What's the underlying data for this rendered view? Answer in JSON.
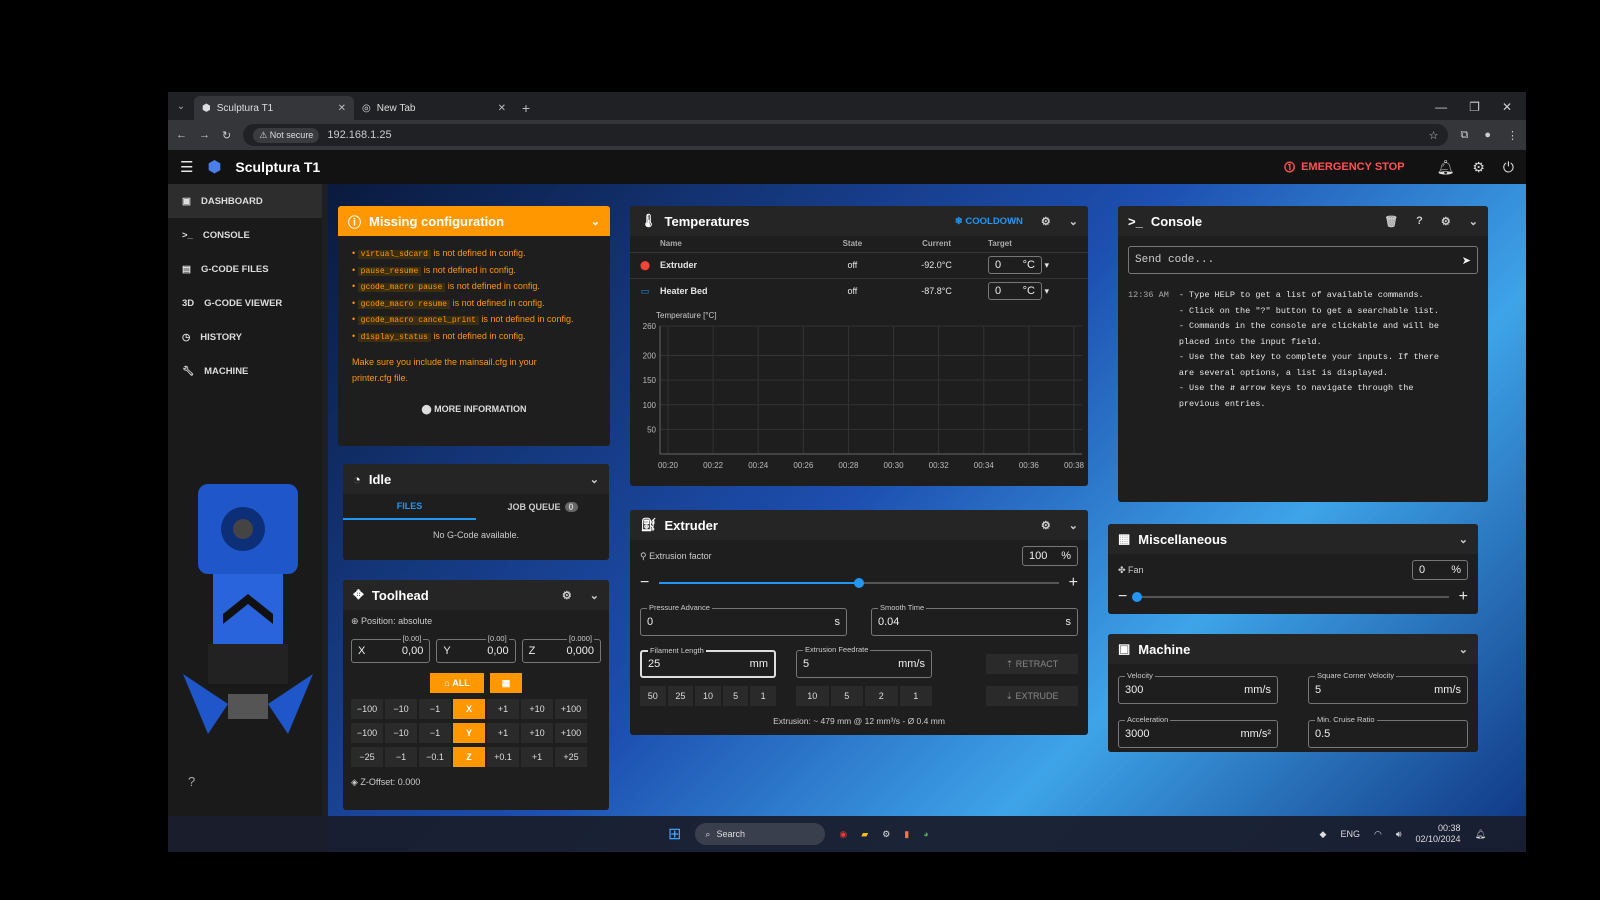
{
  "browser": {
    "tabs": [
      {
        "label": "Sculptura T1"
      },
      {
        "label": "New Tab"
      }
    ],
    "security": "Not secure",
    "url": "192.168.1.25"
  },
  "app": {
    "title": "Sculptura T1",
    "emergency": "EMERGENCY STOP"
  },
  "nav": {
    "items": [
      {
        "label": "DASHBOARD",
        "icon": "dashboard-icon"
      },
      {
        "label": "CONSOLE",
        "icon": "console-icon"
      },
      {
        "label": "G-CODE FILES",
        "icon": "files-icon"
      },
      {
        "label": "G-CODE VIEWER",
        "icon": "3d-icon"
      },
      {
        "label": "HISTORY",
        "icon": "history-icon"
      },
      {
        "label": "MACHINE",
        "icon": "wrench-icon"
      }
    ]
  },
  "missing": {
    "title": "Missing configuration",
    "items": [
      {
        "code": "virtual_sdcard",
        "text": "is not defined in config."
      },
      {
        "code": "pause_resume",
        "text": "is not defined in config."
      },
      {
        "code": "gcode_macro pause",
        "text": "is not defined in config."
      },
      {
        "code": "gcode_macro resume",
        "text": "is not defined in config."
      },
      {
        "code": "gcode_macro cancel_print",
        "text": "is not defined in config."
      },
      {
        "code": "display_status",
        "text": "is not defined in config."
      }
    ],
    "note1": "Make sure you include the mainsail.cfg in your",
    "note2": "printer.cfg file.",
    "more": "MORE INFORMATION"
  },
  "idle": {
    "title": "Idle",
    "tab_files": "FILES",
    "tab_queue": "JOB QUEUE",
    "queue_count": "0",
    "empty": "No G-Code available."
  },
  "toolhead": {
    "title": "Toolhead",
    "position": "Position: absolute",
    "x": {
      "label": "X",
      "value": "0,00",
      "hint": "[0.00]"
    },
    "y": {
      "label": "Y",
      "value": "0,00",
      "hint": "[0.00]"
    },
    "z": {
      "label": "Z",
      "value": "0,000",
      "hint": "[0.000]"
    },
    "home_all": "ALL",
    "rows": [
      [
        "−100",
        "−10",
        "−1",
        "X",
        "+1",
        "+10",
        "+100"
      ],
      [
        "−100",
        "−10",
        "−1",
        "Y",
        "+1",
        "+10",
        "+100"
      ],
      [
        "−25",
        "−1",
        "−0.1",
        "Z",
        "+0.1",
        "+1",
        "+25"
      ]
    ],
    "zoffset": "Z-Offset: 0.000"
  },
  "temps": {
    "title": "Temperatures",
    "cooldown": "COOLDOWN",
    "headers": [
      "Name",
      "State",
      "Current",
      "Target"
    ],
    "rows": [
      {
        "name": "Extruder",
        "state": "off",
        "current": "-92.0°C",
        "target": "0",
        "unit": "°C"
      },
      {
        "name": "Heater Bed",
        "state": "off",
        "current": "-87.8°C",
        "target": "0",
        "unit": "°C"
      }
    ],
    "chart_label": "Temperature [°C]"
  },
  "chart_data": {
    "type": "line",
    "title": "",
    "ylabel": "Temperature [°C]",
    "y_ticks": [
      260,
      200,
      150,
      100,
      50
    ],
    "x_ticks": [
      "00:20",
      "00:22",
      "00:24",
      "00:26",
      "00:28",
      "00:30",
      "00:32",
      "00:34",
      "00:36",
      "00:38"
    ],
    "ylim": [
      0,
      260
    ],
    "series": []
  },
  "extruder": {
    "title": "Extruder",
    "factor_label": "Extrusion factor",
    "factor": "100",
    "factor_unit": "%",
    "factor_level": 0.5,
    "pressure_label": "Pressure Advance",
    "pressure": "0",
    "pressure_unit": "s",
    "smooth_label": "Smooth Time",
    "smooth": "0.04",
    "smooth_unit": "s",
    "length_label": "Filament Length",
    "length": "25",
    "length_unit": "mm",
    "feed_label": "Extrusion Feedrate",
    "feed": "5",
    "feed_unit": "mm/s",
    "retract": "RETRACT",
    "extrude": "EXTRUDE",
    "length_presets": [
      "50",
      "25",
      "10",
      "5",
      "1"
    ],
    "feed_presets": [
      "10",
      "5",
      "2",
      "1"
    ],
    "info": "Extrusion: ~ 479 mm @ 12 mm³/s - Ø 0.4 mm"
  },
  "console": {
    "title": "Console",
    "placeholder": "Send code...",
    "time": "12:36 AM",
    "lines": [
      "- Type HELP to get a list of available commands.",
      "- Click on the \"?\" button to get a searchable list.",
      "- Commands in the console are clickable and will be",
      "placed into the input field.",
      "- Use the tab key to complete your inputs. If there",
      "are several options, a list is displayed.",
      "- Use the ⇵ arrow keys to navigate through the",
      "previous entries."
    ]
  },
  "misc": {
    "title": "Miscellaneous",
    "fan_label": "Fan",
    "fan": "0",
    "fan_unit": "%",
    "fan_level": 0.0
  },
  "machine": {
    "title": "Machine",
    "velocity_label": "Velocity",
    "velocity": "300",
    "velocity_unit": "mm/s",
    "scv_label": "Square Corner Velocity",
    "scv": "5",
    "scv_unit": "mm/s",
    "accel_label": "Acceleration",
    "accel": "3000",
    "accel_unit": "mm/s²",
    "cruise_label": "Min. Cruise Ratio",
    "cruise": "0.5"
  },
  "taskbar": {
    "search": "Search",
    "lang": "ENG",
    "time": "00:38",
    "date": "02/10/2024"
  },
  "colors": {
    "accent": "#2196f3",
    "warning": "#ff9800",
    "danger": "#ff5252"
  }
}
